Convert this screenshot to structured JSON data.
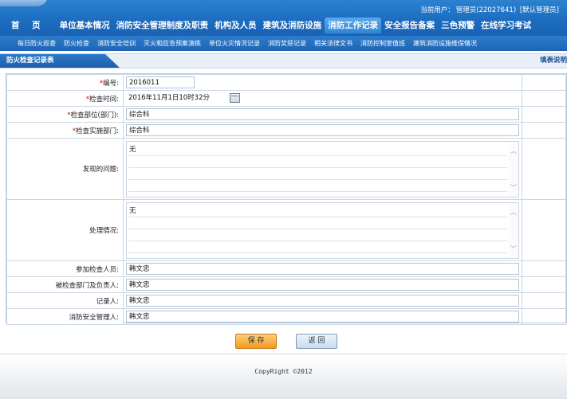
{
  "header": {
    "current_user_label": "当前用户：",
    "current_user": "管理员(22027641)",
    "default_admin_link": "[默认管理员]"
  },
  "nav": {
    "items": [
      "首 页",
      "单位基本情况",
      "消防安全管理制度及职责",
      "机构及人员",
      "建筑及消防设施",
      "消防工作记录",
      "安全报告备案",
      "三色预警",
      "在线学习考试"
    ],
    "active_index": 5
  },
  "subnav": {
    "items": [
      "每日防火巡查",
      "防火检查",
      "消防安全培训",
      "灭火和应急预案演练",
      "单位火灾情况记录",
      "消防奖惩记录",
      "相关法律文书",
      "消防控制室值班",
      "建筑消防设施维保情况"
    ]
  },
  "panel": {
    "title": "防火检查记录表",
    "help_link": "填表说明"
  },
  "form": {
    "required_mark": "*",
    "fields": {
      "number": {
        "label": "编号:",
        "value": "2016011"
      },
      "check_time": {
        "label": "检查时间:",
        "value": "2016年11月1日10时32分"
      },
      "check_dept": {
        "label": "检查部位(部门):",
        "value": "综合科"
      },
      "impl_dept": {
        "label": "检查实施部门:",
        "value": "综合科"
      },
      "problems": {
        "label": "发现的问题:",
        "value": "无"
      },
      "handling": {
        "label": "处理情况:",
        "value": "无"
      },
      "participants": {
        "label": "参加检查人员:",
        "value": "韩文忠"
      },
      "inspected_head": {
        "label": "被检查部门及负责人:",
        "value": "韩文忠"
      },
      "recorder": {
        "label": "记录人:",
        "value": "韩文忠"
      },
      "safety_manager": {
        "label": "消防安全管理人:",
        "value": "韩文忠"
      }
    }
  },
  "buttons": {
    "save": "保 存",
    "back": "返 回"
  },
  "footer": {
    "copyright": "CopyRight ©2012"
  },
  "colors": {
    "header_blue": "#1b6bbf",
    "save_orange": "#f39a1d",
    "required_red": "#d40000"
  }
}
